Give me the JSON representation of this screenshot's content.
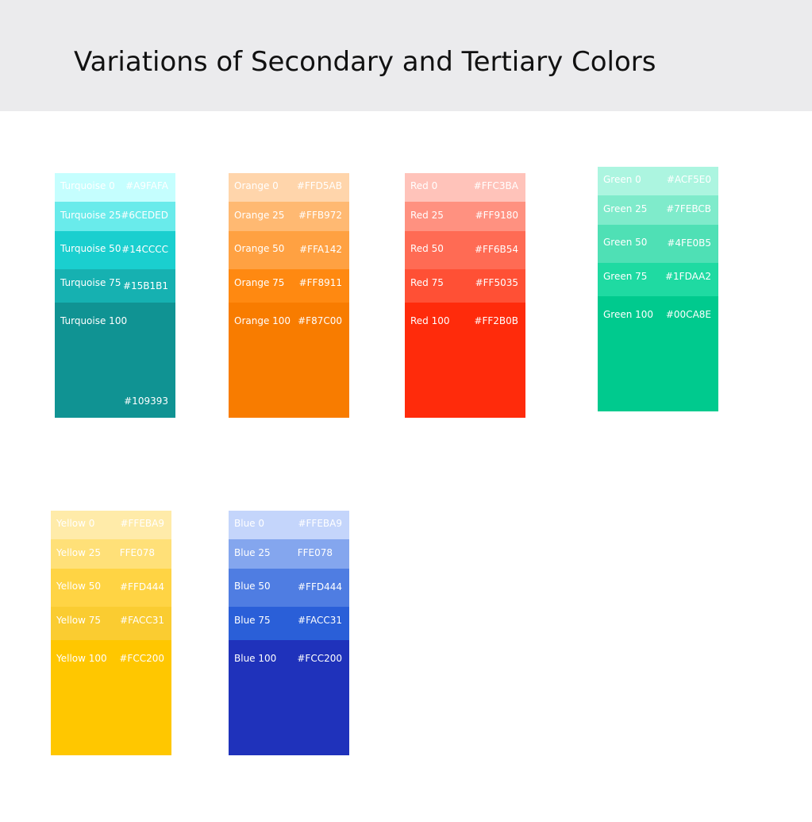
{
  "header": {
    "title": "Variations of Secondary and Tertiary Colors"
  },
  "palettes": [
    {
      "swatches": [
        {
          "label": "Turquoise 0",
          "hex": "#A9FAFA",
          "color": "#C5FEFE"
        },
        {
          "label": "Turquoise 25",
          "hex": "#6CEDED",
          "color": "#69EBEB"
        },
        {
          "label": "Turquoise 50",
          "hex": "#14CCCC",
          "color": "#1ACFCF"
        },
        {
          "label": "Turquoise 75",
          "hex": "#15B1B1",
          "color": "#16B1B1"
        },
        {
          "label": "Turquoise 100",
          "hex": "#109393",
          "color": "#109393"
        }
      ]
    },
    {
      "swatches": [
        {
          "label": "Orange 0",
          "hex": "#FFD5AB",
          "color": "#FFD5AB"
        },
        {
          "label": "Orange 25",
          "hex": "#FFB972",
          "color": "#FFB972"
        },
        {
          "label": "Orange 50",
          "hex": "#FFA142",
          "color": "#FFA142"
        },
        {
          "label": "Orange 75",
          "hex": "#FF8911",
          "color": "#FF8911"
        },
        {
          "label": "Orange 100",
          "hex": "#F87C00",
          "color": "#F87C00"
        }
      ]
    },
    {
      "swatches": [
        {
          "label": "Red 0",
          "hex": "#FFC3BA",
          "color": "#FFC3BA"
        },
        {
          "label": "Red 25",
          "hex": "#FF9180",
          "color": "#FF9180"
        },
        {
          "label": "Red 50",
          "hex": "#FF6B54",
          "color": "#FF6B54"
        },
        {
          "label": "Red 75",
          "hex": "#FF5035",
          "color": "#FF5035"
        },
        {
          "label": "Red 100",
          "hex": "#FF2B0B",
          "color": "#FF2B0B"
        }
      ]
    },
    {
      "swatches": [
        {
          "label": "Green 0",
          "hex": "#ACF5E0",
          "color": "#ACF5E0"
        },
        {
          "label": "Green 25",
          "hex": "#7FEBCB",
          "color": "#7FEBCB"
        },
        {
          "label": "Green 50",
          "hex": "#4FE0B5",
          "color": "#4FE0B5"
        },
        {
          "label": "Green 75",
          "hex": "#1FDAA2",
          "color": "#1FDAA2"
        },
        {
          "label": "Green 100",
          "hex": "#00CA8E",
          "color": "#00CA8E"
        }
      ]
    },
    {
      "swatches": [
        {
          "label": "Yellow 0",
          "hex": "#FFEBA9",
          "color": "#FFEBA9"
        },
        {
          "label": "Yellow 25",
          "hex": "FFE078",
          "color": "#FFE078"
        },
        {
          "label": "Yellow 50",
          "hex": "#FFD444",
          "color": "#FFD444"
        },
        {
          "label": "Yellow 75",
          "hex": "#FACC31",
          "color": "#FACC31"
        },
        {
          "label": "Yellow 100",
          "hex": "#FCC200",
          "color": "#FFC700"
        }
      ]
    },
    {
      "swatches": [
        {
          "label": "Blue 0",
          "hex": "#FFEBA9",
          "color": "#C4D5FB"
        },
        {
          "label": "Blue 25",
          "hex": "FFE078",
          "color": "#84A6EE"
        },
        {
          "label": "Blue 50",
          "hex": "#FFD444",
          "color": "#4F7DE2"
        },
        {
          "label": "Blue 75",
          "hex": "#FACC31",
          "color": "#2A5FD8"
        },
        {
          "label": "Blue 100",
          "hex": "#FCC200",
          "color": "#1F32BB"
        }
      ]
    }
  ]
}
